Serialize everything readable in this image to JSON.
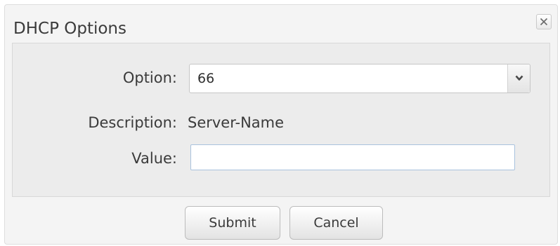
{
  "dialog": {
    "title": "DHCP Options",
    "close_icon": "close-icon"
  },
  "form": {
    "option_label": "Option:",
    "option_value": "66",
    "description_label": "Description:",
    "description_value": "Server-Name",
    "value_label": "Value:",
    "value_input": ""
  },
  "buttons": {
    "submit_label": "Submit",
    "cancel_label": "Cancel"
  },
  "colors": {
    "dialog_bg": "#f4f4f4",
    "panel_bg": "#ececec",
    "input_focus_border": "#a9c2de",
    "text": "#3a3a3a"
  }
}
